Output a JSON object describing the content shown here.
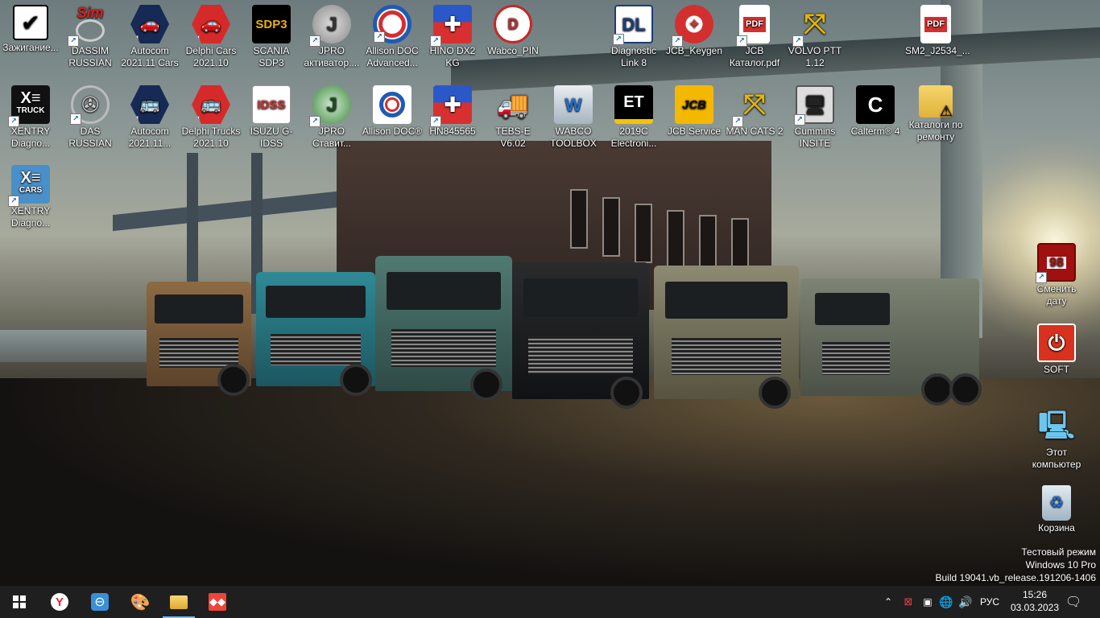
{
  "desktop": {
    "icons": [
      {
        "label": "Зажигание..."
      },
      {
        "label": "DASSIM RUSSIAN",
        "glyph": "Sim"
      },
      {
        "label": "Autocom 2021.11 Cars"
      },
      {
        "label": "Delphi Cars 2021.10"
      },
      {
        "label": "SCANIA SDP3",
        "glyph": "SDP3"
      },
      {
        "label": "JPRO активатор...."
      },
      {
        "label": "Allison DOC Advanced..."
      },
      {
        "label": "HINO DX2 KG"
      },
      {
        "label": "Wabco_PIN"
      },
      {
        "label": "Diagnostic Link 8"
      },
      {
        "label": "JCB_Keygen"
      },
      {
        "label": "JCB Каталог.pdf",
        "glyph": "PDF"
      },
      {
        "label": "VOLVO PTT 1.12"
      },
      {
        "label": "SM2_J2534_...",
        "glyph": "PDF"
      },
      {
        "label": "XENTRY Diagno...",
        "glyph": "TRUCK"
      },
      {
        "label": "DAS RUSSIAN"
      },
      {
        "label": "Autocom 2021.11..."
      },
      {
        "label": "Delphi Trucks 2021.10"
      },
      {
        "label": "ISUZU G-IDSS",
        "glyph": "IDSS"
      },
      {
        "label": "JPRO Ставит..."
      },
      {
        "label": "Allison DOC®"
      },
      {
        "label": "HN845565"
      },
      {
        "label": "TEBS-E V6.02"
      },
      {
        "label": "WABCO TOOLBOX"
      },
      {
        "label": "2019C Electroni...",
        "glyph": "ET"
      },
      {
        "label": "JCB Service",
        "glyph": "JCB"
      },
      {
        "label": "MAN CATS 2"
      },
      {
        "label": "Cummins INSITE"
      },
      {
        "label": "Calterm® 4"
      },
      {
        "label": "Каталоги по ремонту"
      },
      {
        "label": "XENTRY Diagno...",
        "glyph": "CARS"
      },
      {
        "label": "Сменить дату",
        "glyph": "98"
      },
      {
        "label": "SOFT"
      },
      {
        "label": "Этот компьютер"
      },
      {
        "label": "Корзина"
      }
    ]
  },
  "watermark": {
    "line1": "Тестовый режим",
    "line2": "Windows 10 Pro",
    "line3": "Build 19041.vb_release.191206-1406"
  },
  "taskbar": {
    "language": "РУС",
    "time": "15:26",
    "date": "03.03.2023"
  }
}
